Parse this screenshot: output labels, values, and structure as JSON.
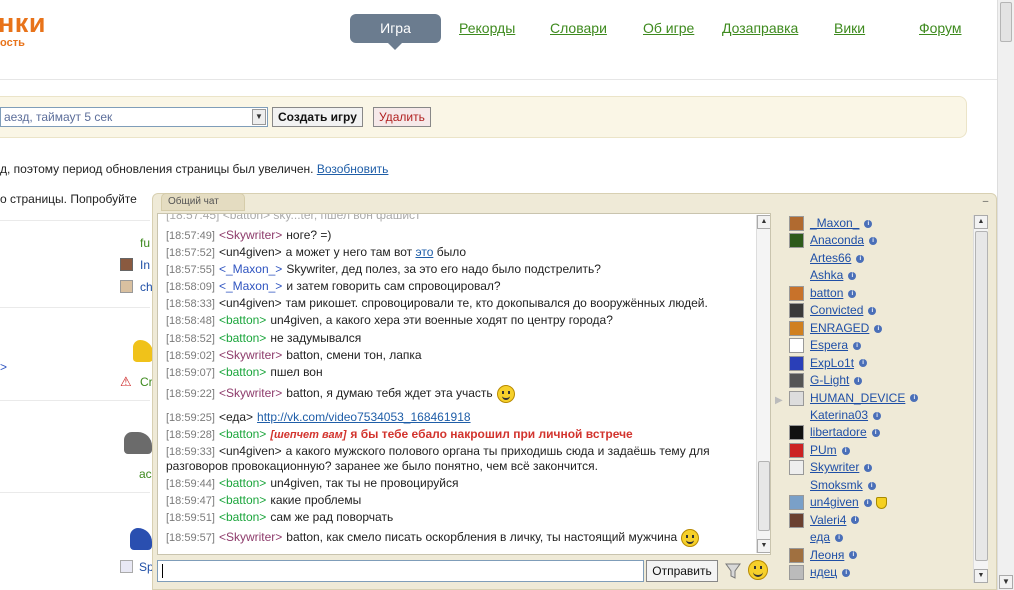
{
  "logo": {
    "text": "нки",
    "sub": "ость"
  },
  "nav": [
    {
      "label": "Игра",
      "active": true
    },
    {
      "label": "Рекорды"
    },
    {
      "label": "Словари"
    },
    {
      "label": "Об игре"
    },
    {
      "label": "Дозаправка"
    },
    {
      "label": "Вики"
    },
    {
      "label": "Форум"
    }
  ],
  "create": {
    "select_value": "аезд, таймаут 5 сек",
    "create_label": "Создать игру",
    "delete_label": "Удалить"
  },
  "notice": {
    "text": "д, поэтому период обновления страницы был увеличен.",
    "link": "Возобновить",
    "text2": "о страницы. Попробуйте"
  },
  "left_fragments": [
    "fu",
    "In",
    "ch",
    "Cr",
    "ac",
    "Sp",
    ">"
  ],
  "chat": {
    "tab": "Общий чат",
    "minimize": "–",
    "partial_top": "[18:57:45] <batton> sky...ter, пшел вон фашист",
    "messages": [
      {
        "time": "[18:57:49]",
        "author": "<Skywriter>",
        "color": "p",
        "text": "ноге? =)"
      },
      {
        "time": "[18:57:52]",
        "author": "<un4given>",
        "color": "k",
        "text": "а может у него там вот ",
        "link": "это",
        "after": " было"
      },
      {
        "time": "[18:57:55]",
        "author": "<_Maxon_>",
        "color": "b",
        "text": "Skywriter, дед полез, за это его надо было подстрелить?"
      },
      {
        "time": "[18:58:09]",
        "author": "<_Maxon_>",
        "color": "b",
        "text": "и затем говорить сам спровоцировал?"
      },
      {
        "time": "[18:58:33]",
        "author": "<un4given>",
        "color": "k",
        "text": "там рикошет. спровоцировали те, кто докопывался до вооружённых людей."
      },
      {
        "time": "[18:58:48]",
        "author": "<batton>",
        "color": "g",
        "text": "un4given, а какого хера эти военные ходят по центру города?"
      },
      {
        "time": "[18:58:52]",
        "author": "<batton>",
        "color": "g",
        "text": "не задумывался"
      },
      {
        "time": "[18:59:02]",
        "author": "<Skywriter>",
        "color": "p",
        "text": "batton, смени тон, лапка"
      },
      {
        "time": "[18:59:07]",
        "author": "<batton>",
        "color": "g",
        "text": "пшел вон"
      },
      {
        "time": "[18:59:22]",
        "author": "<Skywriter>",
        "color": "p",
        "text": "batton, я думаю тебя ждет эта участь",
        "smiley": true
      },
      {
        "time": "[18:59:25]",
        "author": "<еда>",
        "color": "k",
        "text": "",
        "link": "http://vk.com/video7534053_168461918"
      },
      {
        "time": "[18:59:28]",
        "author": "<batton>",
        "color": "g",
        "whisper": "[шепчет вам]",
        "redtext": "я бы тебе ебало накрошил при личной встрече"
      },
      {
        "time": "[18:59:33]",
        "author": "<un4given>",
        "color": "k",
        "text": "а какого мужского полового органа ты приходишь сюда и задаёшь тему для",
        "cont": "разговоров провокационную? заранее же было понятно, чем всё закончится."
      },
      {
        "time": "[18:59:44]",
        "author": "<batton>",
        "color": "g",
        "text": "un4given, так ты не провоцируйся"
      },
      {
        "time": "[18:59:47]",
        "author": "<batton>",
        "color": "g",
        "text": "какие проблемы"
      },
      {
        "time": "[18:59:51]",
        "author": "<batton>",
        "color": "g",
        "text": "сам же рад поворчать"
      },
      {
        "time": "[18:59:57]",
        "author": "<Skywriter>",
        "color": "p",
        "text": "batton, как смело писать оскорбления в личку, ты настоящий мужчина",
        "smiley": true
      }
    ],
    "send_label": "Отправить",
    "input_value": ""
  },
  "users": [
    {
      "name": "_Maxon_",
      "av": "#b06a30"
    },
    {
      "name": "Anaconda",
      "av": "#2d5a1a"
    },
    {
      "name": "Artes66",
      "av": "none"
    },
    {
      "name": "Ashka",
      "av": "none"
    },
    {
      "name": "batton",
      "av": "#c8722a"
    },
    {
      "name": "Convicted",
      "av": "#3a3a3a"
    },
    {
      "name": "ENRAGED",
      "av": "#d08020"
    },
    {
      "name": "Espera",
      "av": "#ffffff"
    },
    {
      "name": "ExpLo1t",
      "av": "#2a3fb8"
    },
    {
      "name": "G-Light",
      "av": "#555555"
    },
    {
      "name": "HUMAN_DEVICE",
      "av": "#dddddd"
    },
    {
      "name": "Katerina03",
      "av": "none"
    },
    {
      "name": "libertadore",
      "av": "#111111"
    },
    {
      "name": "PUm",
      "av": "#cc2222"
    },
    {
      "name": "Skywriter",
      "av": "#eeeeee"
    },
    {
      "name": "Smoksmk",
      "av": "none"
    },
    {
      "name": "un4given",
      "av": "#7aa0c8",
      "badge": true
    },
    {
      "name": "Valeri4",
      "av": "#6a4030"
    },
    {
      "name": "еда",
      "av": "none"
    },
    {
      "name": "Леоня",
      "av": "#a07040"
    },
    {
      "name": "ндец",
      "av": "#bbbbbb"
    }
  ]
}
